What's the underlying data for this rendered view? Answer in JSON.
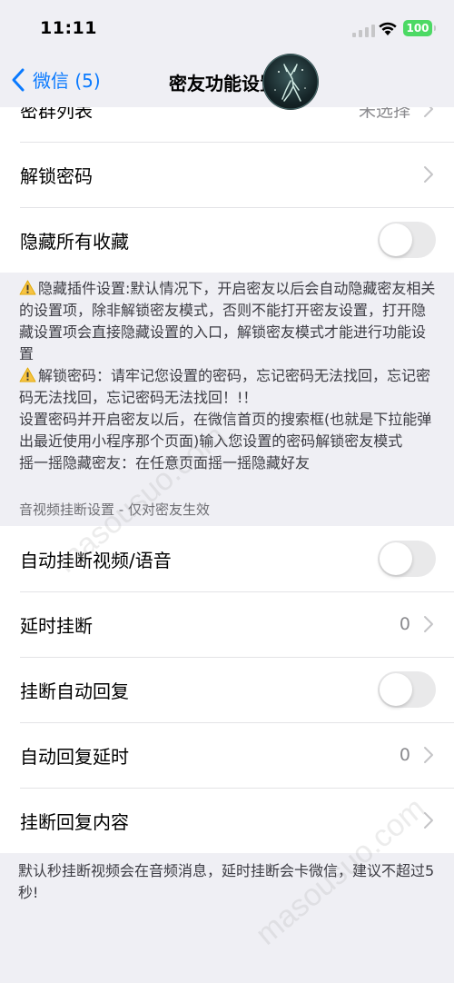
{
  "status_bar": {
    "time": "11:11",
    "battery": "100"
  },
  "nav": {
    "back_label": "微信 (5)",
    "title": "密友功能设置"
  },
  "rows_top": [
    {
      "label": "密群列表",
      "value": "未选择"
    },
    {
      "label": "解锁密码"
    },
    {
      "label": "隐藏所有收藏",
      "toggle": false
    }
  ],
  "notes": [
    "隐藏插件设置:默认情况下，开启密友以后会自动隐藏密友相关的设置项，除非解锁密友模式，否则不能打开密友设置，打开隐藏设置项会直接隐藏设置的入口，解锁密友模式才能进行功能设置",
    "解锁密码：请牢记您设置的密码，忘记密码无法找回，忘记密码无法找回，忘记密码无法找回！!！",
    "设置密码并开启密友以后，在微信首页的搜索框(也就是下拉能弹出最近使用小程序那个页面)输入您设置的密码解锁密友模式",
    "摇一摇隐藏密友：在任意页面摇一摇隐藏好友"
  ],
  "section_header": "音视频挂断设置 - 仅对密友生效",
  "rows_bottom": [
    {
      "label": "自动挂断视频/语音",
      "toggle": false
    },
    {
      "label": "延时挂断",
      "value": "0"
    },
    {
      "label": "挂断自动回复",
      "toggle": false
    },
    {
      "label": "自动回复延时",
      "value": "0"
    },
    {
      "label": "挂断回复内容"
    }
  ],
  "footer_note": "默认秒挂断视频会在音频消息，延时挂断会卡微信，建议不超过5秒!",
  "watermark": "masousuo.com",
  "colors": {
    "accent": "#0a7aff",
    "background": "#efeff4",
    "toggle_off": "#e9e9ea",
    "battery": "#4cd964"
  }
}
